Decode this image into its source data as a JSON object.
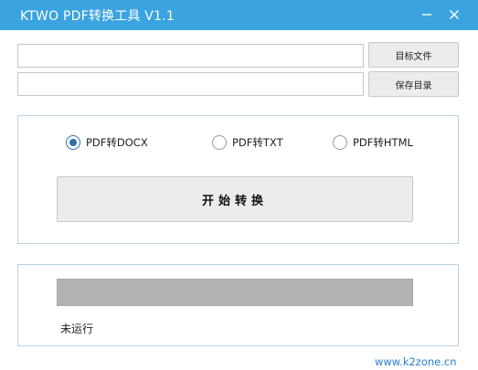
{
  "window": {
    "title": "KTWO PDF转换工具 V1.1",
    "minimize_glyph": "—",
    "close_glyph": "✕"
  },
  "inputs": {
    "target_file_value": "",
    "save_dir_value": ""
  },
  "buttons": {
    "target_file": "目标文件",
    "save_dir": "保存目录",
    "start": "开始转换"
  },
  "options": [
    {
      "label": "PDF转DOCX",
      "checked": true
    },
    {
      "label": "PDF转TXT",
      "checked": false
    },
    {
      "label": "PDF转HTML",
      "checked": false
    }
  ],
  "progress": {
    "value": 0
  },
  "status": {
    "text": "未运行"
  },
  "footer": {
    "link": "www.k2zone.cn"
  },
  "colors": {
    "titlebar": "#3aa3e0",
    "radio_checked": "#2f6fa8",
    "link": "#2a7fd0",
    "progress_track": "#b3b3b3"
  }
}
